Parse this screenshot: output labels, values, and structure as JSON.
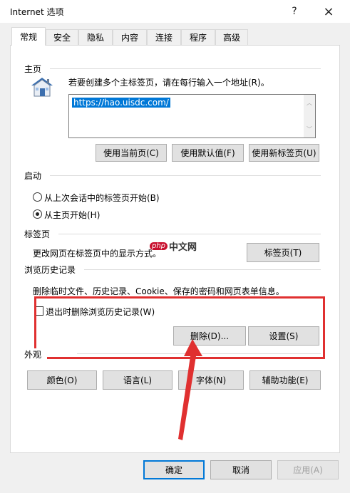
{
  "window": {
    "title": "Internet 选项",
    "help": "?",
    "close": "×"
  },
  "tabs": [
    {
      "label": "常规"
    },
    {
      "label": "安全"
    },
    {
      "label": "隐私"
    },
    {
      "label": "内容"
    },
    {
      "label": "连接"
    },
    {
      "label": "程序"
    },
    {
      "label": "高级"
    }
  ],
  "home": {
    "group_title": "主页",
    "description": "若要创建多个主标签页，请在每行输入一个地址(R)。",
    "url": "https://hao.uisdc.com/",
    "buttons": {
      "current": "使用当前页(C)",
      "default": "使用默认值(F)",
      "new_tab": "使用新标签页(U)"
    }
  },
  "startup": {
    "group_title": "启动",
    "options": [
      {
        "label": "从上次会话中的标签页开始(B)",
        "checked": false
      },
      {
        "label": "从主页开始(H)",
        "checked": true
      }
    ]
  },
  "tabs_group": {
    "group_title": "标签页",
    "description": "更改网页在标签页中的显示方式。",
    "button": "标签页(T)"
  },
  "history": {
    "group_title": "浏览历史记录",
    "description": "删除临时文件、历史记录、Cookie、保存的密码和网页表单信息。",
    "checkbox_label": "退出时删除浏览历史记录(W)",
    "checkbox_checked": false,
    "delete_button": "删除(D)...",
    "settings_button": "设置(S)"
  },
  "appearance": {
    "group_title": "外观",
    "buttons": {
      "colors": "颜色(O)",
      "languages": "语言(L)",
      "fonts": "字体(N)",
      "accessibility": "辅助功能(E)"
    }
  },
  "watermark": {
    "php": "php",
    "cn": "中文网"
  },
  "footer": {
    "ok": "确定",
    "cancel": "取消",
    "apply": "应用(A)"
  },
  "colors": {
    "accent": "#0078d7",
    "highlight_red": "#e03030",
    "watermark": "#c8102e"
  }
}
